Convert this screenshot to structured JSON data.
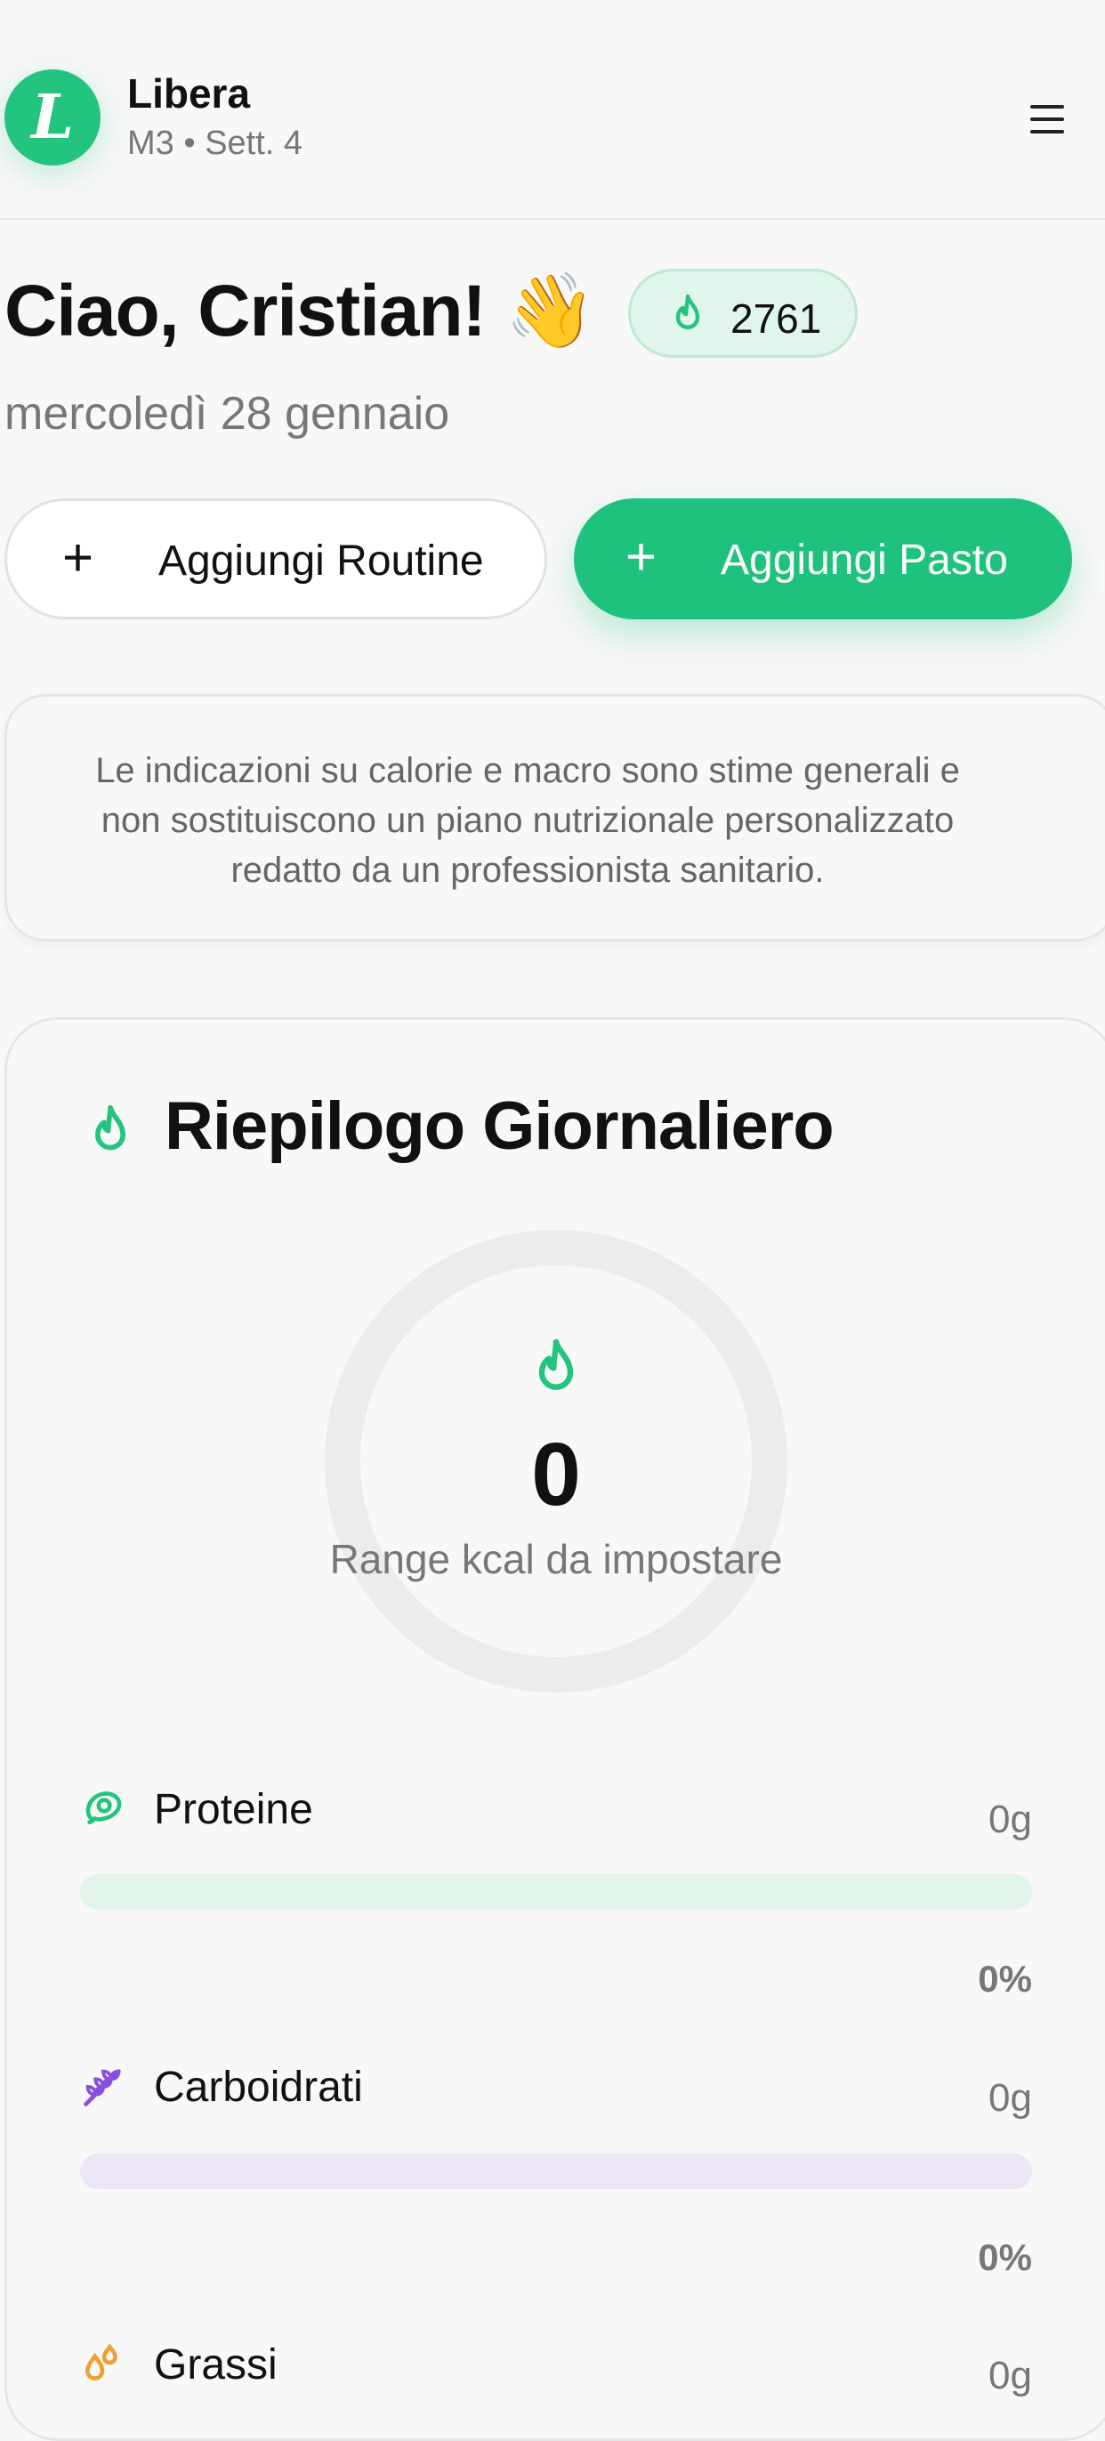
{
  "header": {
    "brand_initial": "L",
    "brand_name": "Libera",
    "brand_subtitle": "M3 • Sett. 4"
  },
  "greeting": {
    "text": "Ciao, Cristian! 👋",
    "streak_value": "2761",
    "date": "mercoledì 28 gennaio"
  },
  "actions": {
    "routine_label": "Aggiungi Routine",
    "meal_label": "Aggiungi Pasto",
    "plus": "+"
  },
  "disclaimer": "Le indicazioni su calorie e macro sono stime generali e non sostituiscono un piano nutrizionale personalizzato redatto da un professionista sanitario.",
  "summary": {
    "title": "Riepilogo Giornaliero",
    "kcal_value": "0",
    "kcal_label": "Range kcal da impostare",
    "kcal_progress": 0
  },
  "macros": [
    {
      "name": "Proteine",
      "value": "0g",
      "percent_label": "0%",
      "progress": 0,
      "icon": "meat-icon",
      "color": "#22c47e",
      "track": "#e0f4ea"
    },
    {
      "name": "Carboidrati",
      "value": "0g",
      "percent_label": "0%",
      "progress": 0,
      "icon": "wheat-icon",
      "color": "#8b4fe0",
      "track": "#ece6f6"
    },
    {
      "name": "Grassi",
      "value": "0g",
      "percent_label": "",
      "progress": 0,
      "icon": "drops-icon",
      "color": "#f0a030",
      "track": "#f8ecd8"
    }
  ],
  "colors": {
    "accent": "#1fc27c",
    "accent_light": "#e0f6ec"
  }
}
